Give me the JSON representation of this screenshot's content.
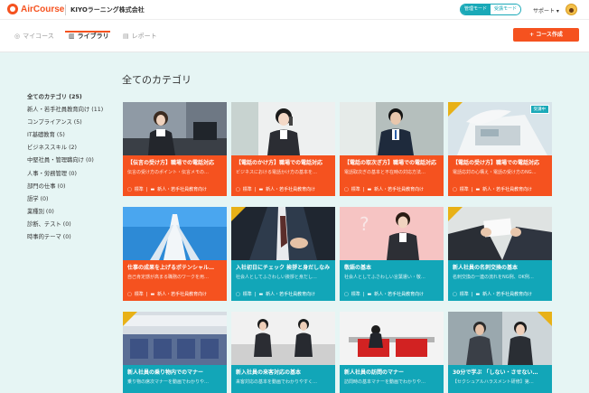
{
  "header": {
    "logo_text": "AirCourse",
    "company": "KIYOラーニング株式会社",
    "mode_admin": "管理モード",
    "mode_learner": "受講モード",
    "support": "サポート ▾"
  },
  "nav": {
    "tabs": [
      {
        "label": "マイコース",
        "icon": "compass-icon"
      },
      {
        "label": "ライブラリ",
        "icon": "library-icon"
      },
      {
        "label": "レポート",
        "icon": "chart-icon"
      }
    ],
    "create_button": "+ コース作成"
  },
  "page_title": "全てのカテゴリ",
  "sidebar": {
    "categories": [
      "全てのカテゴリ (25)",
      "新人・若手社員教育向け (11)",
      "コンプライアンス (5)",
      "IT基礎教育 (5)",
      "ビジネススキル (2)",
      "中堅社員・管理職向け (0)",
      "人事・労務管理 (0)",
      "部門の仕事 (0)",
      "語学 (0)",
      "業種別 (0)",
      "診断、テスト (0)",
      "時事的テーマ (0)"
    ]
  },
  "cards": [
    {
      "title": "【伝言の受け方】職場での電話対応",
      "desc": "伝言の受け方のポイント・伝言メモの…",
      "tag": "標準",
      "category": "新人・若手社員教育向け",
      "color": "#f5521f"
    },
    {
      "title": "【電話のかけ方】職場での電話対応",
      "desc": "ビジネスにおける電話かけ方の基本を…",
      "tag": "標準",
      "category": "新人・若手社員教育向け",
      "color": "#f5521f"
    },
    {
      "title": "【電話の取次ぎ方】職場での電話対応",
      "desc": "電話取次ぎの基本と不在時の対応方法…",
      "tag": "標準",
      "category": "新人・若手社員教育向け",
      "color": "#f5521f"
    },
    {
      "title": "【電話の受け方】職場での電話対応",
      "desc": "電話応対の心構え・電話の受け方のNG…",
      "tag": "標準",
      "category": "新人・若手社員教育向け",
      "color": "#f5521f",
      "badge": "受講中"
    },
    {
      "title": "仕事の成果を上げるポテンシャル…",
      "desc": "自己肯定感が高まる職務のワークを用…",
      "tag": "標準",
      "category": "新人・若手社員教育向け",
      "color": "#f5521f"
    },
    {
      "title": "入社初日にチェック 挨拶と身だしなみ",
      "desc": "社会人としてふさわしい挨拶と身だし…",
      "tag": "標準",
      "category": "新人・若手社員教育向け",
      "color": "#12a6b8"
    },
    {
      "title": "敬語の基本",
      "desc": "社会人としてふさわしい言葉遣い・敬…",
      "tag": "標準",
      "category": "新人・若手社員教育向け",
      "color": "#12a6b8"
    },
    {
      "title": "新人社員の名刺交換の基本",
      "desc": "名刺交換の一連の流れをNG例、OK例…",
      "tag": "標準",
      "category": "新人・若手社員教育向け",
      "color": "#12a6b8"
    },
    {
      "title": "新人社員の乗り物内でのマナー",
      "desc": "乗り物の席次マナーを動画でわかりや…",
      "tag": "",
      "category": "",
      "color": "#12a6b8"
    },
    {
      "title": "新入社員の来客対応の基本",
      "desc": "来客対応の基本を動画でわかりやすく…",
      "tag": "",
      "category": "",
      "color": "#12a6b8"
    },
    {
      "title": "新人社員の訪問のマナー",
      "desc": "訪問時の基本マナーを動画でわかりや…",
      "tag": "",
      "category": "",
      "color": "#12a6b8"
    },
    {
      "title": "30分で学ぶ 「しない・させない…",
      "desc": "【セクシュアルハラスメント研修】第…",
      "tag": "",
      "category": "",
      "color": "#12a6b8"
    }
  ],
  "colors": {
    "accent": "#f5521f",
    "teal": "#12a6b8",
    "background": "#e6f5f4"
  }
}
